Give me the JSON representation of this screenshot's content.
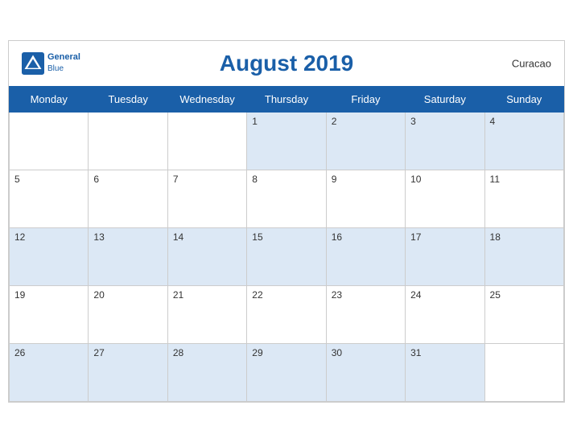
{
  "header": {
    "title": "August 2019",
    "country": "Curacao",
    "logo_general": "General",
    "logo_blue": "Blue"
  },
  "weekdays": [
    "Monday",
    "Tuesday",
    "Wednesday",
    "Thursday",
    "Friday",
    "Saturday",
    "Sunday"
  ],
  "weeks": [
    [
      null,
      null,
      null,
      1,
      2,
      3,
      4
    ],
    [
      5,
      6,
      7,
      8,
      9,
      10,
      11
    ],
    [
      12,
      13,
      14,
      15,
      16,
      17,
      18
    ],
    [
      19,
      20,
      21,
      22,
      23,
      24,
      25
    ],
    [
      26,
      27,
      28,
      29,
      30,
      31,
      null
    ]
  ]
}
